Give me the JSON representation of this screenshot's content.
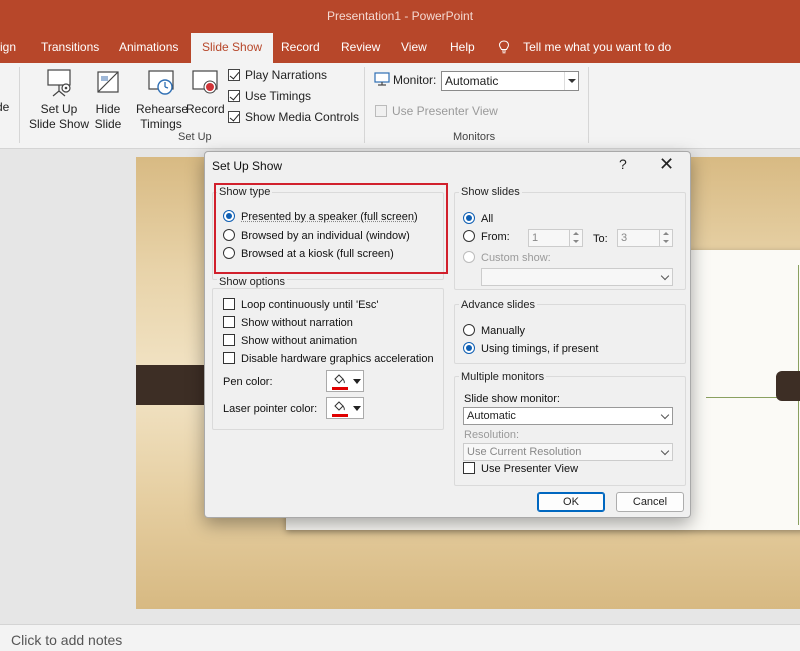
{
  "window": {
    "title": "Presentation1  -  PowerPoint"
  },
  "tabs": [
    {
      "label": "ign"
    },
    {
      "label": "Transitions"
    },
    {
      "label": "Animations"
    },
    {
      "label": "Slide Show",
      "active": true
    },
    {
      "label": "Record"
    },
    {
      "label": "Review"
    },
    {
      "label": "View"
    },
    {
      "label": "Help"
    }
  ],
  "tell_me": "Tell me what you want to do",
  "ribbon": {
    "partial_label": "de",
    "setup_show": {
      "line1": "Set Up",
      "line2": "Slide Show"
    },
    "hide_slide": {
      "line1": "Hide",
      "line2": "Slide"
    },
    "rehearse": {
      "line1": "Rehearse",
      "line2": "Timings"
    },
    "record": {
      "line1": "Record",
      "line2": ""
    },
    "checks": {
      "play_narrations": {
        "label": "Play Narrations",
        "checked": true
      },
      "use_timings": {
        "label": "Use Timings",
        "checked": true
      },
      "show_media_controls": {
        "label": "Show Media Controls",
        "checked": true
      }
    },
    "setup_group_label": "Set Up",
    "monitor_label": "Monitor:",
    "monitor_value": "Automatic",
    "use_presenter_view": "Use Presenter View",
    "monitors_group_label": "Monitors"
  },
  "notes": {
    "placeholder": "Click to add notes"
  },
  "dialog": {
    "title": "Set Up Show",
    "help": "?",
    "close": "✕",
    "show_type": {
      "title": "Show type",
      "options": [
        {
          "label": "Presented by a speaker (full screen)",
          "selected": true
        },
        {
          "label": "Browsed by an individual (window)",
          "selected": false
        },
        {
          "label": "Browsed at a kiosk (full screen)",
          "selected": false
        }
      ]
    },
    "show_options": {
      "title": "Show options",
      "loop": "Loop continuously until 'Esc'",
      "no_narration": "Show without narration",
      "no_animation": "Show without animation",
      "disable_hw": "Disable hardware graphics acceleration",
      "pen_color_label": "Pen color:",
      "laser_color_label": "Laser pointer color:"
    },
    "show_slides": {
      "title": "Show slides",
      "all": "All",
      "from": "From:",
      "from_value": "1",
      "to": "To:",
      "to_value": "3",
      "custom_show": "Custom show:"
    },
    "advance_slides": {
      "title": "Advance slides",
      "manually": "Manually",
      "using_timings": "Using timings, if present"
    },
    "multiple_monitors": {
      "title": "Multiple monitors",
      "monitor_label": "Slide show monitor:",
      "monitor_value": "Automatic",
      "resolution_label": "Resolution:",
      "resolution_value": "Use Current Resolution",
      "presenter_view": "Use Presenter View"
    },
    "ok": "OK",
    "cancel": "Cancel"
  },
  "colors": {
    "accent": "#b7472a",
    "highlight": "#d1202c",
    "radio": "#0f5fb3"
  }
}
